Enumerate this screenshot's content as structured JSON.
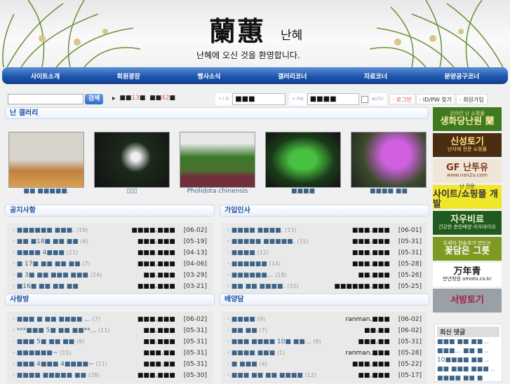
{
  "header": {
    "logo_hanja": "蘭蕙",
    "logo_korean": "난혜",
    "welcome": "난혜에 오신 것을 환영합니다."
  },
  "nav": [
    "사이트소개",
    "회원광장",
    "행사소식",
    "갤러리코너",
    "자료코너",
    "분양공구코너"
  ],
  "search": {
    "value": "",
    "button": "검색"
  },
  "stats": {
    "prefix1": "■■",
    "count1": "13",
    "suffix1": "■",
    "prefix2": "■■",
    "count2": "42",
    "suffix2": "■"
  },
  "login": {
    "id_label": "+ I D",
    "id_value": "■■■",
    "pw_label": "+ PW",
    "pw_value": "■■■■",
    "auto_label": "AUTO",
    "login_btn": "· 로그인",
    "find_btn": "· ID/PW 찾기",
    "join_btn": "· 회원가입"
  },
  "gallery": {
    "title": "난 갤러리",
    "items": [
      {
        "caption": "■■ ■■■■■."
      },
      {
        "caption": "▯▯▯"
      },
      {
        "caption": "Pholidota chinensis"
      },
      {
        "caption": "■■■■"
      },
      {
        "caption": "■■■■ ■■"
      }
    ]
  },
  "boards": [
    {
      "title": "공지사항",
      "rows": [
        {
          "title": "■■■■■■ ■■■.",
          "count": "(19)",
          "author": "■■■■.■■■",
          "date": "[06-02]"
        },
        {
          "title": "■■ ■18■ ■■ ■■",
          "count": "(6)",
          "author": "■■■.■■■",
          "date": "[05-19]"
        },
        {
          "title": "■■■■ 4■■■",
          "count": "(21)",
          "author": "■■■.■■■",
          "date": "[04-13]"
        },
        {
          "title": "■ 17■ ■■ ■■ ■■",
          "count": "(7)",
          "author": "■■■.■■■",
          "date": "[04-06]"
        },
        {
          "title": "■ 3■ ■■ ■■■ ■■■",
          "count": "(24)",
          "author": "■■.■■■",
          "date": "[03-29]"
        },
        {
          "title": "■16■ ■■ ■■ ■■",
          "count": "",
          "author": "■■■.■■■",
          "date": "[03-21]"
        }
      ]
    },
    {
      "title": "가입인사",
      "rows": [
        {
          "title": "■■■■ ■■■■.",
          "count": "(15)",
          "author": "■■■.■■■",
          "date": "[06-01]"
        },
        {
          "title": "■■■■■ ■■■■■.",
          "count": "(15)",
          "author": "■■■.■■■",
          "date": "[05-31]"
        },
        {
          "title": "■■■■",
          "count": "(12)",
          "author": "■■■.■■■",
          "date": "[05-31]"
        },
        {
          "title": "■■■■■■",
          "count": "(14)",
          "author": "■■■.■■■",
          "date": "[05-28]"
        },
        {
          "title": "■■■■■■...",
          "count": "(18)",
          "author": "■■.■■■",
          "date": "[05-26]"
        },
        {
          "title": "■■ ■■ ■■■■.",
          "count": "(32)",
          "author": "■■■■■■.■■■",
          "date": "[05-25]"
        }
      ]
    },
    {
      "title": "사랑방",
      "rows": [
        {
          "title": "■■■ ■ ■■ ■■■■ ...",
          "count": "(7)",
          "author": "■■■.■■■",
          "date": "[06-02]"
        },
        {
          "title": "***■■■ 5■ ■■ ■■**...",
          "count": "(11)",
          "author": "■■.■■■",
          "date": "[05-31]"
        },
        {
          "title": "■■■ 5■ ■■ ■■",
          "count": "(8)",
          "author": "■■.■■■",
          "date": "[05-31]"
        },
        {
          "title": "■■■■■■~",
          "count": "(15)",
          "author": "■■■.■■",
          "date": "[05-31]"
        },
        {
          "title": "■■■ 4■■■ 4■■■■~",
          "count": "(11)",
          "author": "■■■.■■",
          "date": "[05-31]"
        },
        {
          "title": "■■■■ ■■■■■ ■■",
          "count": "(28)",
          "author": "■■■.■■■",
          "date": "[05-30]"
        }
      ]
    },
    {
      "title": "배양담",
      "rows": [
        {
          "title": "■■■■",
          "count": "(9)",
          "author": "ranman.■■■",
          "date": "[06-02]"
        },
        {
          "title": "■■ ■■",
          "count": "(7)",
          "author": "■■.■■",
          "date": "[06-02]"
        },
        {
          "title": "■■■ ■■■■ 10■ ■■...",
          "count": "(8)",
          "author": "■■■.■■",
          "date": "[05-31]"
        },
        {
          "title": "■■■■ ■■■",
          "count": "(1)",
          "author": "ranman.■■■",
          "date": "[05-28]"
        },
        {
          "title": "■ ■■■",
          "count": "(4)",
          "author": "■■■.■■■",
          "date": "[05-22]"
        },
        {
          "title": "■■■ ■■ ■■ ■■■■",
          "count": "(12)",
          "author": "■■.■■■",
          "date": "[05-17]"
        }
      ]
    }
  ],
  "banners": [
    {
      "top": "온라인 난 쇼핑몰",
      "main": "생화당난원 蘭",
      "bg": "#3f7a22",
      "fg": "#f3e9a0"
    },
    {
      "top": "",
      "main": "신성토기",
      "sub": "난자재 전문 쇼핑몰",
      "bg": "#4a2c10",
      "fg": "#ffe680"
    },
    {
      "top": "",
      "main": "GF 난투유",
      "sub": "www.nan2u.com",
      "bg": "#efe6d8",
      "fg": "#7a3a1a"
    },
    {
      "top": "난 전문",
      "main": "사이트/쇼핑몰 개발",
      "bg": "#f0e62a",
      "fg": "#333"
    },
    {
      "top": "",
      "main": "자우비료",
      "sub": "건강한 춘란배양-자우바이오",
      "bg": "#1f5a1f",
      "fg": "#e8f4c8"
    },
    {
      "top": "오세자 한솔호가 만드는",
      "main": "꽃담은 그릇",
      "bg": "#7f9a22",
      "fg": "#fff"
    },
    {
      "top": "",
      "main": "万年青",
      "sub": "만년청원 omoto.co.kr",
      "bg": "#ffffff",
      "fg": "#222"
    },
    {
      "top": "",
      "main": "서방토기",
      "bg": "#9aa0a6",
      "fg": "#a0204a"
    }
  ],
  "recent_comments": {
    "title": "최신 댓글",
    "items": [
      "■■■ ■■ ■■ ..",
      "■■■... ■■ ■ ..",
      "10■■■■ ■■ ..",
      "■■ ■■■ ■■■ ..",
      "■■■■ ■■ ■"
    ]
  }
}
